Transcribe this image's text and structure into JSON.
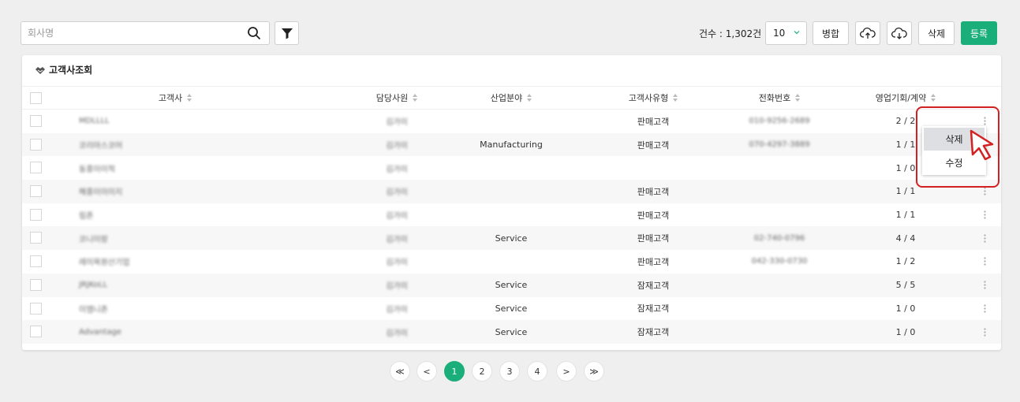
{
  "search": {
    "placeholder": "회사명"
  },
  "toolbar": {
    "count_label": "건수 : 1,302건",
    "page_size": "10",
    "merge_label": "병합",
    "delete_label": "삭제",
    "register_label": "등록"
  },
  "colors": {
    "accent": "#1aaf7a",
    "highlight": "#d32020"
  },
  "card": {
    "title": "고객사조회"
  },
  "columns": [
    "고객사",
    "담당사원",
    "산업분야",
    "고객사유형",
    "전화번호",
    "영업기회/계약"
  ],
  "rows": [
    {
      "company": "MDLLLL",
      "staff": "김가이",
      "industry": "",
      "type": "판매고객",
      "phone": "010-9256-2689",
      "deal": "2 / 2"
    },
    {
      "company": "코리아스코어",
      "staff": "김가이",
      "industry": "Manufacturing",
      "type": "판매고객",
      "phone": "070-4297-3889",
      "deal": "1 / 1"
    },
    {
      "company": "동흥이이적",
      "staff": "김가이",
      "industry": "",
      "type": "",
      "phone": "",
      "deal": "1 / 0"
    },
    {
      "company": "해흥이이이지",
      "staff": "김가이",
      "industry": "",
      "type": "판매고객",
      "phone": "",
      "deal": "1 / 1"
    },
    {
      "company": "림존",
      "staff": "김가이",
      "industry": "",
      "type": "판매고객",
      "phone": "",
      "deal": "1 / 1"
    },
    {
      "company": "코니이랑",
      "staff": "김가이",
      "industry": "Service",
      "type": "판매고객",
      "phone": "02-740-0796",
      "deal": "4 / 4"
    },
    {
      "company": "레이목원산기업",
      "staff": "김가이",
      "industry": "",
      "type": "판매고객",
      "phone": "042-330-0730",
      "deal": "1 / 2"
    },
    {
      "company": "JRJKoLL",
      "staff": "김가이",
      "industry": "Service",
      "type": "잠재고객",
      "phone": "",
      "deal": "5 / 5"
    },
    {
      "company": "이엠니존",
      "staff": "김가이",
      "industry": "Service",
      "type": "잠재고객",
      "phone": "",
      "deal": "1 / 0"
    },
    {
      "company": "Advantage",
      "staff": "김가이",
      "industry": "Service",
      "type": "잠재고객",
      "phone": "",
      "deal": "1 / 0"
    }
  ],
  "pagination": {
    "first": "≪",
    "prev": "<",
    "pages": [
      "1",
      "2",
      "3",
      "4"
    ],
    "next": ">",
    "last": "≫"
  },
  "context_menu": {
    "delete": "삭제",
    "edit": "수정"
  }
}
